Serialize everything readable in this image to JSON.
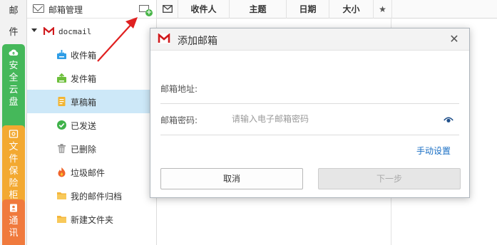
{
  "vertical_tabs": {
    "top_chars": [
      "邮",
      "件"
    ],
    "cloud": "安全云盘",
    "safe": "文件保险柜",
    "contacts": "通讯"
  },
  "folder_panel": {
    "title": "邮箱管理",
    "account": "docmail",
    "folders": [
      {
        "label": "收件箱",
        "icon": "inbox-icon"
      },
      {
        "label": "发件箱",
        "icon": "outbox-icon"
      },
      {
        "label": "草稿箱",
        "icon": "drafts-icon"
      },
      {
        "label": "已发送",
        "icon": "sent-icon"
      },
      {
        "label": "已删除",
        "icon": "trash-icon"
      },
      {
        "label": "垃圾邮件",
        "icon": "spam-icon"
      },
      {
        "label": "我的邮件归档",
        "icon": "archive-folder-icon"
      },
      {
        "label": "新建文件夹",
        "icon": "new-folder-icon"
      }
    ],
    "selected_folder": "草稿箱"
  },
  "list_header": {
    "sender": "收件人",
    "subject": "主题",
    "date": "日期",
    "size": "大小",
    "star": "★"
  },
  "dialog": {
    "title": "添加邮箱",
    "close": "✕",
    "address_label": "邮箱地址:",
    "address_value": "",
    "password_label": "邮箱密码:",
    "password_placeholder": "请输入电子邮箱密码",
    "manual_setup": "手动设置",
    "cancel": "取消",
    "next": "下一步"
  },
  "colors": {
    "accent_blue": "#1a6fc4",
    "brand_red": "#d0191c",
    "cloud_tab": "#45b85a",
    "safe_tab": "#f3a931",
    "contacts_tab": "#f07a3d",
    "selected_row": "#cde8f8",
    "arrow": "#e02020"
  }
}
